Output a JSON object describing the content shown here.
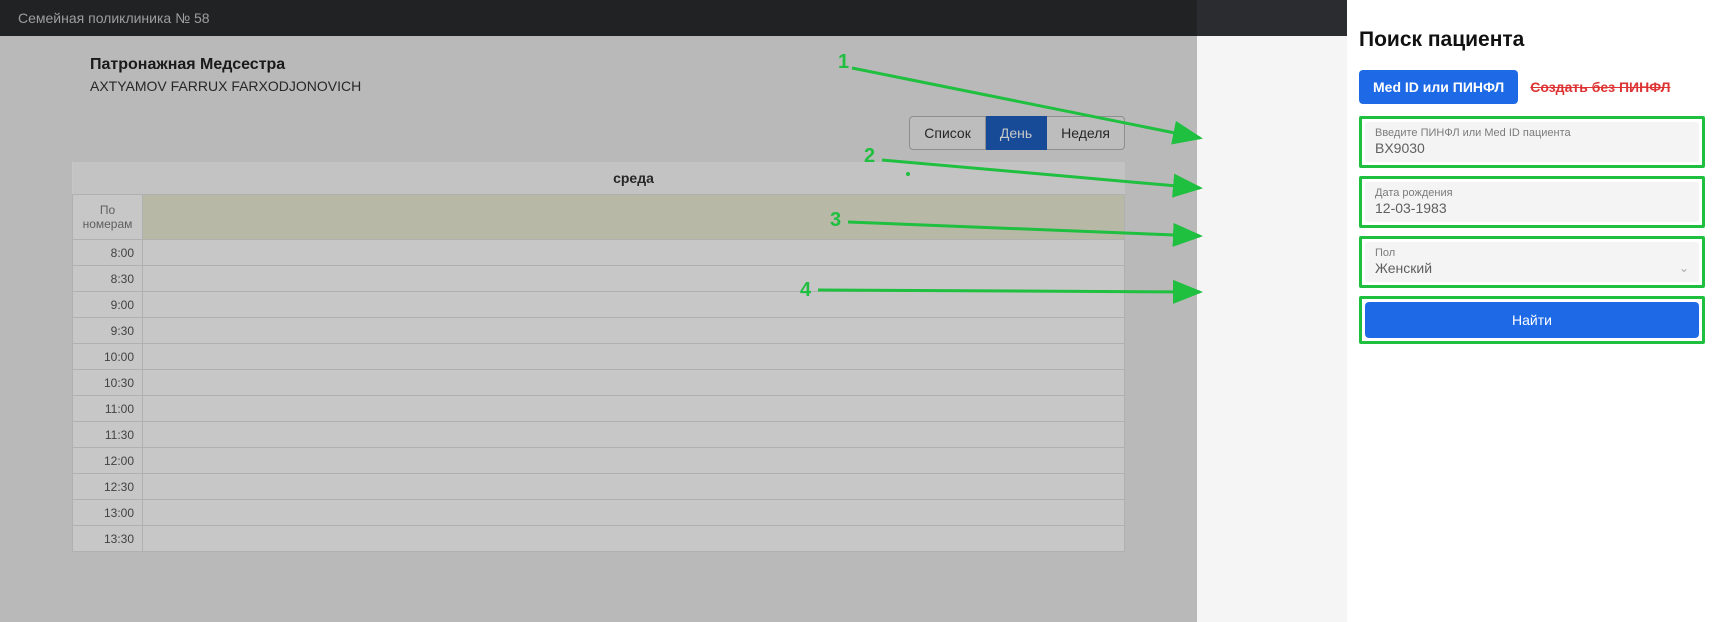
{
  "header": {
    "clinic": "Семейная поликлиника № 58"
  },
  "doctor": {
    "role": "Патронажная Медсестра",
    "name": "AXTYAMOV FARRUX FARXODJONOVICH"
  },
  "view_tabs": {
    "list": "Список",
    "day": "День",
    "week": "Неделя"
  },
  "calendar": {
    "day_heading": "среда",
    "row_label": "По номерам",
    "time_slots": [
      "8:00",
      "8:30",
      "9:00",
      "9:30",
      "10:00",
      "10:30",
      "11:00",
      "11:30",
      "12:00",
      "12:30",
      "13:00",
      "13:30"
    ],
    "now_after": "11:30"
  },
  "panel": {
    "title": "Поиск пациента",
    "tab_active": "Med ID или ПИНФЛ",
    "tab_strike": "Создать без ПИНФЛ",
    "field1": {
      "label": "Введите ПИНФЛ или Med ID пациента",
      "value": "BX9030"
    },
    "field2": {
      "label": "Дата рождения",
      "value": "12-03-1983"
    },
    "field3": {
      "label": "Пол",
      "value": "Женский"
    },
    "find_label": "Найти"
  },
  "annotations": {
    "a1": "1",
    "a2": "2",
    "a3": "3",
    "a4": "4"
  }
}
